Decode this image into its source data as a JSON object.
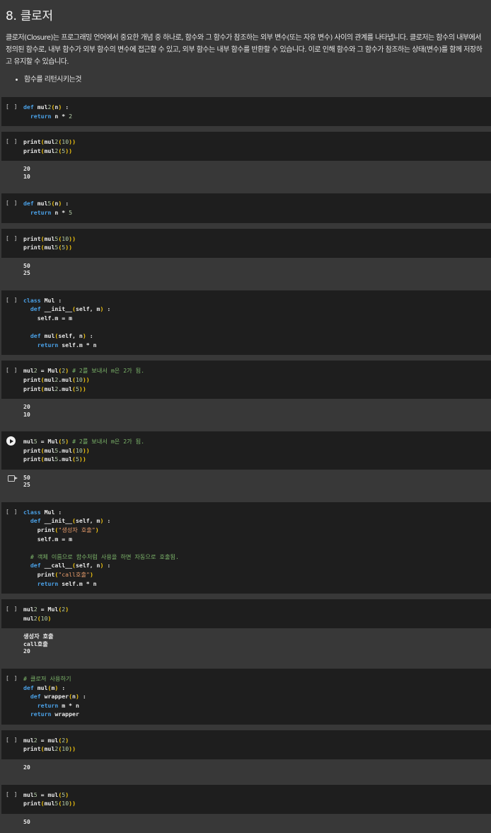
{
  "markdown": {
    "title": "8. 클로저",
    "paragraph": "클로저(Closure)는 프로그래밍 언어에서 중요한 개념 중 하나로, 함수와 그 함수가 참조하는 외부 변수(또는 자유 변수) 사이의 관계를 나타냅니다. 클로저는 함수의 내부에서 정의된 함수로, 내부 함수가 외부 함수의 변수에 접근할 수 있고, 외부 함수는 내부 함수를 반환할 수 있습니다. 이로 인해 함수와 그 함수가 참조하는 상태(변수)를 함께 저장하고 유지할 수 있습니다.",
    "bullet": "함수를 리턴시키는것"
  },
  "run_indicator": "[ ]",
  "cells": [
    {
      "code": "def mul2(n) :\n  return n * 2",
      "output": ""
    },
    {
      "code": "print(mul2(10))\nprint(mul2(5))",
      "output": "20\n10"
    },
    {
      "code": "def mul5(n) :\n  return n * 5",
      "output": ""
    },
    {
      "code": "print(mul5(10))\nprint(mul5(5))",
      "output": "50\n25"
    },
    {
      "code": "class Mul :\n  def __init__(self, m) :\n    self.m = m\n\n  def mul(self, n) :\n    return self.m * n",
      "output": ""
    },
    {
      "code": "mul2 = Mul(2) # 2를 보내서 m은 2가 됨.\nprint(mul2.mul(10))\nprint(mul2.mul(5))",
      "output": "20\n10"
    },
    {
      "code": "mul5 = Mul(5) # 2를 보내서 m은 2가 됨.\nprint(mul5.mul(10))\nprint(mul5.mul(5))",
      "output": "50\n25",
      "active": true
    },
    {
      "code": "class Mul :\n  def __init__(self, m) :\n    print(\"생성자 호출\")\n    self.m = m\n\n  # 객체 이름으로 함수처럼 사용을 하면 자동으로 호출됨.\n  def __call__(self, n) :\n    print(\"call호출\")\n    return self.m * n",
      "output": ""
    },
    {
      "code": "mul2 = Mul(2)\nmul2(10)",
      "output": "생성자 호출\ncall호출\n20"
    },
    {
      "code": "# 클로저 사용하기\ndef mul(m) :\n  def wrapper(n) :\n    return m * n\n  return wrapper",
      "output": ""
    },
    {
      "code": "mul2 = mul(2)\nprint(mul2(10))",
      "output": "20"
    },
    {
      "code": "mul5 = mul(5)\nprint(mul5(10))",
      "output": "50"
    }
  ]
}
